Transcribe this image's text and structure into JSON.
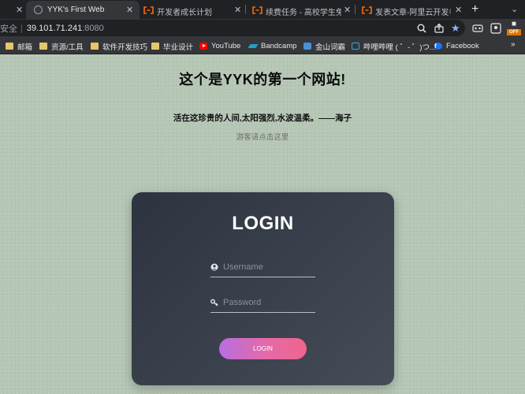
{
  "browser": {
    "tabs": [
      {
        "title": "YYK's First Web",
        "favicon": "globe-icon",
        "active": true
      },
      {
        "title": "开发者成长计划",
        "favicon": "aliyun-icon",
        "active": false
      },
      {
        "title": "续费任务 - 高校学生免费",
        "favicon": "aliyun-icon",
        "active": false
      },
      {
        "title": "发表文章-阿里云开发者社",
        "favicon": "aliyun-icon",
        "active": false
      }
    ],
    "new_tab_label": "+",
    "address": {
      "security_label": "安全",
      "host": "39.101.71.241",
      "port": ":8080"
    },
    "bookmarks": [
      {
        "label": "邮箱",
        "icon": "folder-icon"
      },
      {
        "label": "资源/工具",
        "icon": "folder-icon"
      },
      {
        "label": "软件开发技巧",
        "icon": "folder-icon"
      },
      {
        "label": "毕业设计",
        "icon": "folder-icon"
      },
      {
        "label": "YouTube",
        "icon": "youtube-icon"
      },
      {
        "label": "Bandcamp",
        "icon": "bandcamp-icon"
      },
      {
        "label": "金山词霸",
        "icon": "kingsoft-icon"
      },
      {
        "label": "哔哩哔哩 ( ゜- ゜)つ...",
        "icon": "bilibili-icon"
      },
      {
        "label": "Facebook",
        "icon": "facebook-icon"
      }
    ],
    "extension_badge": "OFF"
  },
  "page": {
    "headline": "这个是YYK的第一个网站!",
    "quote": "活在这珍贵的人间,太阳强烈,水波温柔。——海子",
    "guest_link": "游客请点击这里",
    "login": {
      "title": "LOGIN",
      "username_placeholder": "Username",
      "password_placeholder": "Password",
      "button_label": "LOGIN"
    }
  },
  "colors": {
    "page_background": "#b6c7b5",
    "card_gradient_start": "#2d343f",
    "card_gradient_end": "#454c58",
    "button_gradient_start": "#b86ee0",
    "button_gradient_end": "#f0648e",
    "browser_chrome": "#35363a"
  }
}
